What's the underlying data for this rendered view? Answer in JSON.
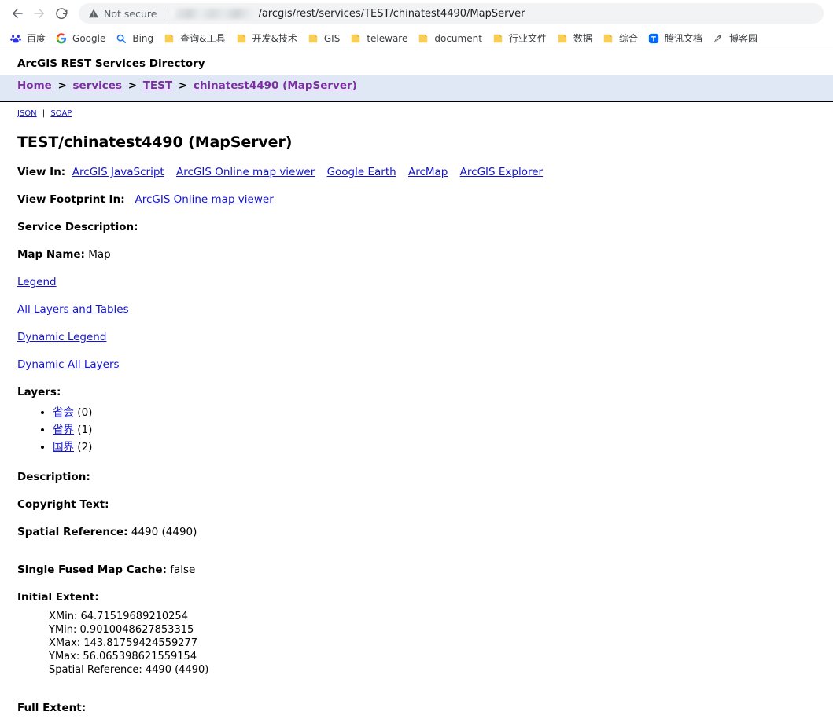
{
  "browser": {
    "back_icon": "back-arrow-icon",
    "forward_icon": "forward-arrow-icon",
    "reload_icon": "reload-icon",
    "security_icon": "not-secure-warning-icon",
    "security_label": "Not secure",
    "url_redacted": true,
    "url_text": "/arcgis/rest/services/TEST/chinatest4490/MapServer",
    "bookmarks": [
      {
        "label": "百度",
        "icon": "baidu-paw-icon",
        "type": "site"
      },
      {
        "label": "Google",
        "icon": "google-g-icon",
        "type": "site"
      },
      {
        "label": "Bing",
        "icon": "bing-search-icon",
        "type": "site"
      },
      {
        "label": "查询&工具",
        "icon": "folder-icon",
        "type": "folder"
      },
      {
        "label": "开发&技术",
        "icon": "folder-icon",
        "type": "folder"
      },
      {
        "label": "GIS",
        "icon": "folder-icon",
        "type": "folder"
      },
      {
        "label": "teleware",
        "icon": "folder-icon",
        "type": "folder"
      },
      {
        "label": "document",
        "icon": "folder-icon",
        "type": "folder"
      },
      {
        "label": "行业文件",
        "icon": "folder-icon",
        "type": "folder"
      },
      {
        "label": "数据",
        "icon": "folder-icon",
        "type": "folder"
      },
      {
        "label": "综合",
        "icon": "folder-icon",
        "type": "folder"
      },
      {
        "label": "腾讯文档",
        "icon": "tencent-docs-icon",
        "type": "site"
      },
      {
        "label": "博客园",
        "icon": "cnblogs-icon",
        "type": "site"
      }
    ]
  },
  "page": {
    "site_header": "ArcGIS REST Services Directory",
    "breadcrumb": [
      {
        "label": "Home"
      },
      {
        "label": "services"
      },
      {
        "label": "TEST"
      },
      {
        "label": "chinatest4490 (MapServer)"
      }
    ],
    "breadcrumb_separator": ">",
    "format_links": [
      {
        "label": "JSON"
      },
      {
        "label": "SOAP"
      }
    ],
    "format_separator": "|",
    "service_title": "TEST/chinatest4490 (MapServer)",
    "view_in": {
      "label": "View In:",
      "links": [
        {
          "label": "ArcGIS JavaScript"
        },
        {
          "label": "ArcGIS Online map viewer"
        },
        {
          "label": "Google Earth"
        },
        {
          "label": "ArcMap"
        },
        {
          "label": "ArcGIS Explorer"
        }
      ]
    },
    "view_footprint_in": {
      "label": "View Footprint In:",
      "links": [
        {
          "label": "ArcGIS Online map viewer"
        }
      ]
    },
    "service_description": {
      "label": "Service Description:",
      "value": ""
    },
    "map_name": {
      "label": "Map Name:",
      "value": "Map"
    },
    "resource_links": [
      {
        "label": "Legend"
      },
      {
        "label": "All Layers and Tables"
      },
      {
        "label": "Dynamic Legend"
      },
      {
        "label": "Dynamic All Layers"
      }
    ],
    "layers": {
      "label": "Layers:",
      "items": [
        {
          "name": "省会",
          "index": "(0)"
        },
        {
          "name": "省界",
          "index": "(1)"
        },
        {
          "name": "国界",
          "index": "(2)"
        }
      ]
    },
    "description": {
      "label": "Description:",
      "value": ""
    },
    "copyright_text": {
      "label": "Copyright Text:",
      "value": ""
    },
    "spatial_reference": {
      "label": "Spatial Reference:",
      "value": "4490  (4490)"
    },
    "single_fused_map_cache": {
      "label": "Single Fused Map Cache:",
      "value": "false"
    },
    "initial_extent": {
      "label": "Initial Extent:",
      "xmin_label": "XMin:",
      "xmin": "64.71519689210254",
      "ymin_label": "YMin:",
      "ymin": "0.9010048627853315",
      "xmax_label": "XMax:",
      "xmax": "143.81759424559277",
      "ymax_label": "YMax:",
      "ymax": "56.065398621559154",
      "sr_label": "Spatial Reference:",
      "sr": "4490  (4490)"
    },
    "full_extent": {
      "label": "Full Extent:"
    }
  },
  "colors": {
    "link": "#1414CC",
    "visited_link": "#7B2FA0",
    "breadcrumb_bg": "#DFE8F4",
    "chrome_omnibox_bg": "#F1F3F4",
    "folder_icon": "#F5C243"
  }
}
